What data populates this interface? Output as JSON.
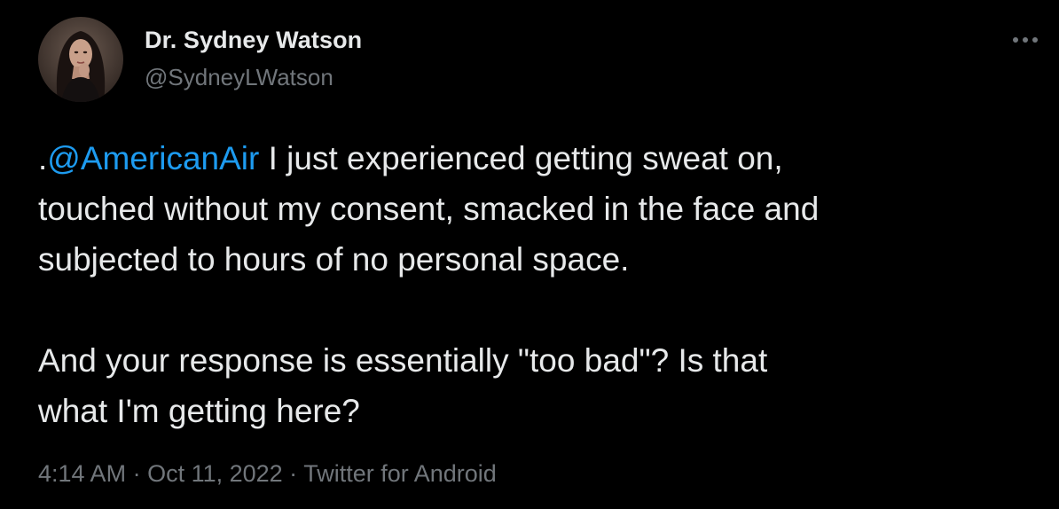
{
  "author": {
    "name": "Dr. Sydney Watson",
    "handle": "@SydneyLWatson"
  },
  "tweet": {
    "mention": "@AmericanAir",
    "line1_prefix": ".",
    "line1_rest": " I just experienced getting sweat on,",
    "line2": "touched without my consent, smacked in the face and",
    "line3": "subjected to hours of no personal space.",
    "line4": "And your response is essentially \"too bad\"? Is that",
    "line5": "what I'm getting here?"
  },
  "meta": {
    "time": "4:14 AM",
    "separator": " · ",
    "date": "Oct 11, 2022",
    "source": "Twitter for Android"
  },
  "icons": {
    "more": "more-horizontal-icon"
  },
  "colors": {
    "background": "#000000",
    "primary_text": "#e7e9ea",
    "secondary_text": "#71767b",
    "link": "#1d9bf0"
  }
}
